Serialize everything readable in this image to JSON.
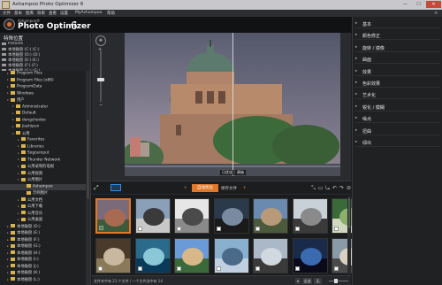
{
  "window": {
    "title": "Ashampoo Photo Optimizer 6",
    "min": "—",
    "max": "☐",
    "close": "✕"
  },
  "menu": {
    "items": [
      "文件",
      "基本",
      "图库",
      "效果",
      "查看",
      "设置",
      "MyAshampoo",
      "帮助"
    ],
    "share_icon": "share-icon"
  },
  "brand": {
    "small": "Ashampoo®",
    "name": "Photo Optimizer",
    "version": "6"
  },
  "left_panel": {
    "title": "特殊位置",
    "drives": [
      "Pictures",
      "本地磁盘 (C:) (C:)",
      "本地磁盘 (D:) (D:)",
      "本地磁盘 (E:) (E:)",
      "本地磁盘 (F:) (F:)",
      "本地磁盘 (G:) (G:)"
    ],
    "tree": [
      {
        "label": "Program Files",
        "indent": 1,
        "arrow": "▸"
      },
      {
        "label": "Program Files (x86)",
        "indent": 1,
        "arrow": "▸"
      },
      {
        "label": "ProgramData",
        "indent": 1,
        "arrow": "▸"
      },
      {
        "label": "Windows",
        "indent": 1,
        "arrow": "▸"
      },
      {
        "label": "用户",
        "indent": 1,
        "arrow": "▾"
      },
      {
        "label": "Administrator",
        "indent": 2,
        "arrow": "▸"
      },
      {
        "label": "Default",
        "indent": 2,
        "arrow": "▸"
      },
      {
        "label": "dongchonbo",
        "indent": 2,
        "arrow": "▸"
      },
      {
        "label": "jiashipun",
        "indent": 2,
        "arrow": "▸"
      },
      {
        "label": "公用",
        "indent": 2,
        "arrow": "▾"
      },
      {
        "label": "Favorites",
        "indent": 3,
        "arrow": "▸"
      },
      {
        "label": "Libraries",
        "indent": 3,
        "arrow": "▸"
      },
      {
        "label": "Sogouinput",
        "indent": 3,
        "arrow": "▸"
      },
      {
        "label": "Thunder Network",
        "indent": 3,
        "arrow": "▸"
      },
      {
        "label": "公用录制的电视",
        "indent": 3,
        "arrow": "▸"
      },
      {
        "label": "公用视频",
        "indent": 3,
        "arrow": "▸"
      },
      {
        "label": "公用图片",
        "indent": 3,
        "arrow": "▾"
      },
      {
        "label": "Ashampoo",
        "indent": 4,
        "arrow": "",
        "selected": true
      },
      {
        "label": "示例图片",
        "indent": 4,
        "arrow": ""
      },
      {
        "label": "公用文档",
        "indent": 3,
        "arrow": "▸"
      },
      {
        "label": "公用下载",
        "indent": 3,
        "arrow": "▸"
      },
      {
        "label": "公用音乐",
        "indent": 3,
        "arrow": "▸"
      },
      {
        "label": "公用桌面",
        "indent": 3,
        "arrow": "▸"
      },
      {
        "label": "本地磁盘 (D:)",
        "indent": 1,
        "arrow": "▸"
      },
      {
        "label": "本地磁盘 (E:)",
        "indent": 1,
        "arrow": "▸"
      },
      {
        "label": "本地磁盘 (F:)",
        "indent": 1,
        "arrow": "▸"
      },
      {
        "label": "本地磁盘 (G:)",
        "indent": 1,
        "arrow": "▸"
      },
      {
        "label": "本地磁盘 (H:)",
        "indent": 1,
        "arrow": "▸"
      },
      {
        "label": "本地磁盘 (I:)",
        "indent": 1,
        "arrow": "▸"
      },
      {
        "label": "本地磁盘 (J:)",
        "indent": 1,
        "arrow": "▸"
      },
      {
        "label": "本地磁盘 (K:)",
        "indent": 1,
        "arrow": "▸"
      },
      {
        "label": "本地磁盘 (L:)",
        "indent": 1,
        "arrow": "▸"
      }
    ]
  },
  "viewer": {
    "before_label": "原始",
    "after_label": "已优化"
  },
  "toolbar": {
    "auto_label": "自动优化",
    "save_label": "保存文件",
    "prev_icon": "‹",
    "next_icon": "›",
    "icons": [
      "⤡",
      "▭",
      "⤿",
      "↶",
      "↷",
      "⊘"
    ]
  },
  "thumbnails": {
    "count": 14,
    "selected_index": 0
  },
  "status": {
    "text": "文件夹中有 21 个文件 / 一个文件选中有 14",
    "buttons": [
      "▾",
      "全选",
      "无",
      "全选"
    ]
  },
  "right_panel": {
    "items": [
      "基本",
      "颜色修正",
      "旋转 / 镜像",
      "曲面",
      "效果",
      "色彩效果",
      "艺术化",
      "锐化 / 模糊",
      "噪点",
      "扭曲",
      "绿出"
    ]
  },
  "colors": {
    "accent": "#e0782c",
    "selection": "#3a8ad8",
    "background": "#1b1c1e"
  }
}
